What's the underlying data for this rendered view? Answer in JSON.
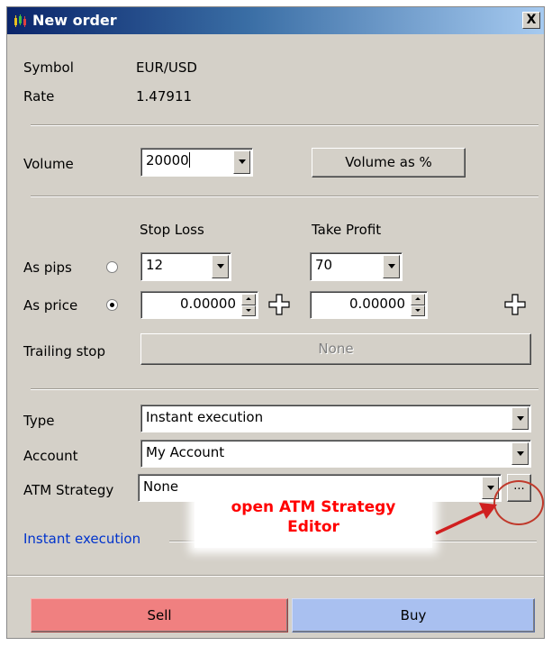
{
  "window": {
    "title": "New order",
    "close_label": "X"
  },
  "symbol": {
    "label": "Symbol",
    "value": "EUR/USD"
  },
  "rate": {
    "label": "Rate",
    "value": "1.47911"
  },
  "volume": {
    "label": "Volume",
    "value": "20000",
    "as_percent_label": "Volume as %"
  },
  "stops": {
    "stop_loss_header": "Stop Loss",
    "take_profit_header": "Take Profit",
    "as_pips_label": "As pips",
    "as_price_label": "As price",
    "stop_loss_pips": "12",
    "take_profit_pips": "70",
    "stop_loss_price": "0.00000",
    "take_profit_price": "0.00000",
    "selected_mode": "As price"
  },
  "trailing_stop": {
    "label": "Trailing stop",
    "value": "None"
  },
  "type": {
    "label": "Type",
    "value": "Instant execution"
  },
  "account": {
    "label": "Account",
    "value": "My Account"
  },
  "atm_strategy": {
    "label": "ATM Strategy",
    "value": "None",
    "editor_button_label": "..."
  },
  "annotation": {
    "line1": "open ATM Strategy",
    "line2": "Editor"
  },
  "status": {
    "text": "Instant execution"
  },
  "actions": {
    "sell_label": "Sell",
    "buy_label": "Buy"
  },
  "colors": {
    "title_bar": "#0a246a",
    "sell": "#f08080",
    "buy": "#a9c0f0",
    "annotation": "#ff0000",
    "status_link": "#0033cc"
  }
}
